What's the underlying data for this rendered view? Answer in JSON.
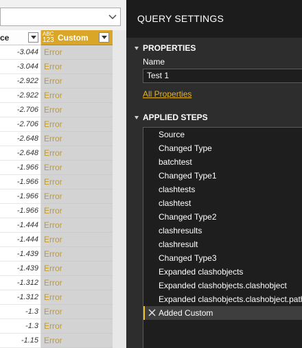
{
  "grid": {
    "column_a_label": "ce",
    "column_b_type": "ABC\n123",
    "column_b_label": "Custom",
    "rows": [
      {
        "value": "-3.044",
        "custom": "Error"
      },
      {
        "value": "-3.044",
        "custom": "Error"
      },
      {
        "value": "-2.922",
        "custom": "Error"
      },
      {
        "value": "-2.922",
        "custom": "Error"
      },
      {
        "value": "-2.706",
        "custom": "Error"
      },
      {
        "value": "-2.706",
        "custom": "Error"
      },
      {
        "value": "-2.648",
        "custom": "Error"
      },
      {
        "value": "-2.648",
        "custom": "Error"
      },
      {
        "value": "-1.966",
        "custom": "Error"
      },
      {
        "value": "-1.966",
        "custom": "Error"
      },
      {
        "value": "-1.966",
        "custom": "Error"
      },
      {
        "value": "-1.966",
        "custom": "Error"
      },
      {
        "value": "-1.444",
        "custom": "Error"
      },
      {
        "value": "-1.444",
        "custom": "Error"
      },
      {
        "value": "-1.439",
        "custom": "Error"
      },
      {
        "value": "-1.439",
        "custom": "Error"
      },
      {
        "value": "-1.312",
        "custom": "Error"
      },
      {
        "value": "-1.312",
        "custom": "Error"
      },
      {
        "value": "-1.3",
        "custom": "Error"
      },
      {
        "value": "-1.3",
        "custom": "Error"
      },
      {
        "value": "-1.15",
        "custom": "Error"
      }
    ]
  },
  "query_settings": {
    "title": "QUERY SETTINGS",
    "properties_title": "PROPERTIES",
    "name_label": "Name",
    "name_value": "Test 1",
    "all_properties_link": "All Properties",
    "applied_steps_title": "APPLIED STEPS",
    "steps": [
      "Source",
      "Changed Type",
      "batchtest",
      "Changed Type1",
      "clashtests",
      "clashtest",
      "Changed Type2",
      "clashresults",
      "clashresult",
      "Changed Type3",
      "Expanded clashobjects",
      "Expanded clashobjects.clashobject",
      "Expanded clashobjects.clashobject.path",
      "Added Custom"
    ],
    "selected_step": "Added Custom"
  },
  "colors": {
    "accent_gold": "#d9a628",
    "error_text": "#c99a16",
    "selection_marker": "#f2c811",
    "panel_bg": "#2d2d2d"
  },
  "icons": [
    "chevron-down-icon",
    "filter-dropdown-icon",
    "type-any-icon",
    "collapse-triangle-icon",
    "delete-step-icon"
  ]
}
